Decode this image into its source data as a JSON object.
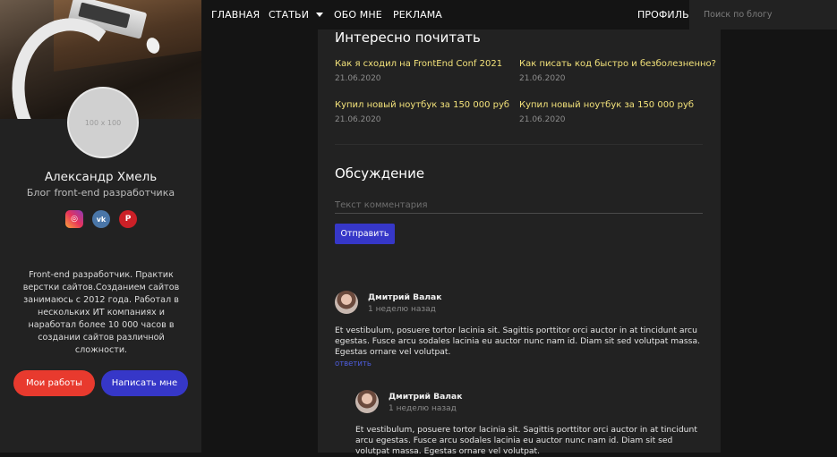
{
  "nav": {
    "items": [
      {
        "label": "ГЛАВНАЯ"
      },
      {
        "label": "СТАТЬИ"
      },
      {
        "label": "ОБО МНЕ"
      },
      {
        "label": "РЕКЛАМА"
      }
    ],
    "profile_label": "ПРОФИЛЬ",
    "search_placeholder": "Поиск по блогу"
  },
  "sidebar": {
    "avatar_placeholder": "100 x 100",
    "name": "Александр Хмель",
    "subtitle": "Блог front-end разработчика",
    "socials": [
      {
        "icon": "instagram-icon",
        "glyph": "◎"
      },
      {
        "icon": "vk-icon",
        "glyph": "vk"
      },
      {
        "icon": "pinterest-icon",
        "glyph": "P"
      }
    ],
    "bio": "Front-end разработчик. Практик верстки сайтов.Созданием сайтов занимаюсь с 2012 года. Работал в нескольких ИТ компаниях и наработал более 10 000 часов в создании сайтов различной сложности.",
    "btn_works": "Мои работы",
    "btn_write": "Написать мне"
  },
  "reading": {
    "title": "Интересно почитать",
    "posts": [
      {
        "title": "Как я сходил на FrontEnd Conf 2021",
        "date": "21.06.2020"
      },
      {
        "title": "Как писать код быстро и безболезненно?",
        "date": "21.06.2020"
      },
      {
        "title": "Купил новый ноутбук за 150 000 руб",
        "date": "21.06.2020"
      },
      {
        "title": "Купил новый ноутбук за 150 000 руб",
        "date": "21.06.2020"
      }
    ]
  },
  "discussion": {
    "title": "Обсуждение",
    "input_placeholder": "Текст комментария",
    "send_label": "Отправить",
    "comments": [
      {
        "author": "Дмитрий Валак",
        "time": "1 неделю назад",
        "text": "Et vestibulum, posuere tortor lacinia sit. Sagittis porttitor orci auctor in at tincidunt arcu egestas. Fusce arcu sodales lacinia eu auctor nunc nam id. Diam sit sed volutpat massa. Egestas ornare vel volutpat.",
        "reply_label": "ответить"
      },
      {
        "author": "Дмитрий Валак",
        "time": "1 неделю назад",
        "text": "Et vestibulum, posuere tortor lacinia sit. Sagittis porttitor orci auctor in at tincidunt arcu egestas. Fusce arcu sodales lacinia eu auctor nunc nam id. Diam sit sed volutpat massa. Egestas ornare vel volutpat."
      }
    ]
  },
  "colors": {
    "accent_blue": "#3637c8",
    "accent_red": "#e83a2e",
    "post_title": "#f3e27a",
    "background": "#141414",
    "panel": "#222222"
  }
}
